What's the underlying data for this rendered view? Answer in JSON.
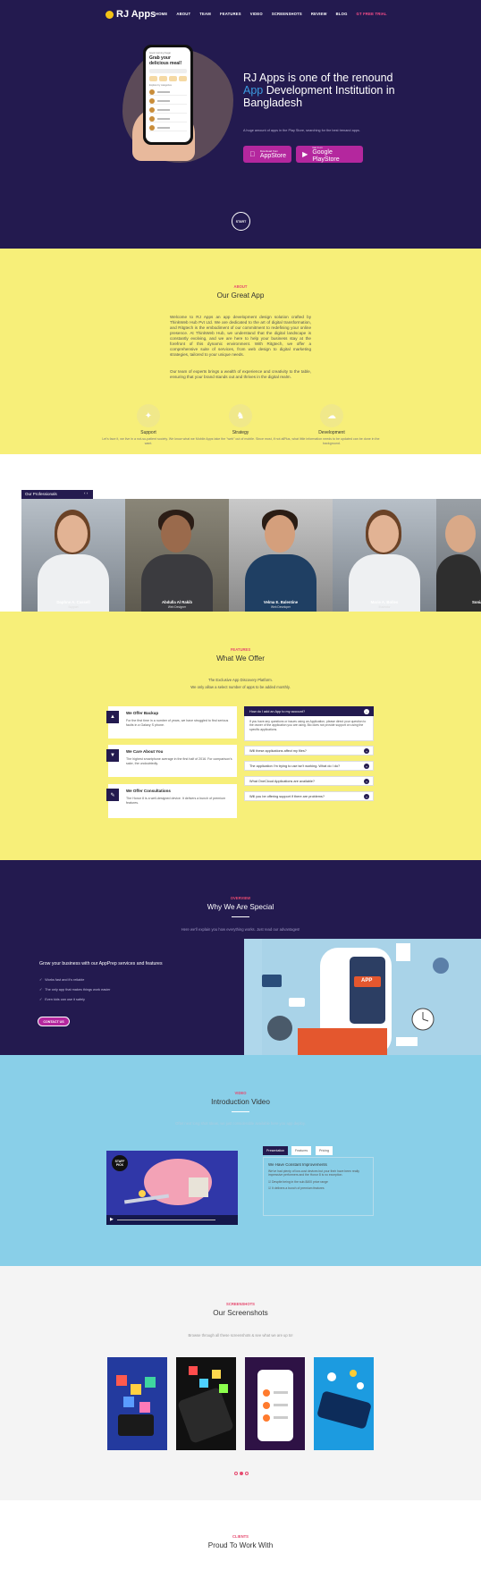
{
  "nav": {
    "logo": "RJ Apps",
    "links": [
      "HOME",
      "ABOUT",
      "TEAM",
      "FEATURES",
      "VIDEO",
      "SCREENSHOTS",
      "REVIEW",
      "BLOG",
      "GT FREE TRIAL"
    ]
  },
  "hero": {
    "phone": {
      "subtitle": "Good morning Sugar",
      "title": "Grab your delicious meal!",
      "list_title": "Explore by categories"
    },
    "title_before": "RJ Apps is one of the renound ",
    "title_accent": "App",
    "title_after": " Development Institution in Bangladesh",
    "subtitle": "A huge amount of apps in the Play Store, searching for the best trenand apps.",
    "appstore": {
      "small": "Download from",
      "big": "AppStore"
    },
    "playstore": {
      "small": "Get it on",
      "big": "Google PlayStore"
    },
    "start": "START"
  },
  "about": {
    "kicker": "ABOUT",
    "title": "Our Great App",
    "para1": "Welcome to RJ Apps an app development design solution crafted by ThinkWeb Hub Pvt Ltd. We are dedicated to the art of digital transformation, and Ritgtech is the embodiment of our commitment to redefining your online presence. At ThinkWeb Hub, we understand that the digital landscape is constantly evolving, and we are here to help your business stay at the forefront of this dynamic environment. With Ritgtech, we offer a comprehensive suite of services, from web design to digital marketing strategies, tailored to your unique needs.",
    "para2": "Our team of experts brings a wealth of experience and creativity to the table, ensuring that your brand stands out and thrives in the digital realm.",
    "features": [
      {
        "title": "Support",
        "desc": "Let's face it, we live in a not-so-patient society. We know what we want.",
        "icon": "support-icon",
        "glyph": "✦"
      },
      {
        "title": "Strategy",
        "desc": "Mobile Apps take the \"web\" out of mobile. Since most, if not all.",
        "icon": "strategy-icon",
        "glyph": "♞"
      },
      {
        "title": "Development",
        "desc": "Plus, what little information needs to be updated can be done in the background.",
        "icon": "development-icon",
        "glyph": "☁"
      }
    ]
  },
  "team": {
    "label": "Our Professionals",
    "arrows": "‹ ›",
    "members": [
      {
        "name": "Daphne A. Cassell",
        "role": "Support"
      },
      {
        "name": "Abdulla Al Rakib",
        "role": "Web Designer"
      },
      {
        "name": "Velma E. Balentine",
        "role": "Web Developer"
      },
      {
        "name": "Marie A. Bolles",
        "role": "Illustrator"
      },
      {
        "name": "Sonia",
        "role": ""
      }
    ]
  },
  "features": {
    "kicker": "FEATURES",
    "title": "What We Offer",
    "sub1": "The Exclusive App Discovery Platform.",
    "sub2": "We only allow a select number of apps to be added monthly.",
    "cards": [
      {
        "title": "We Offer Backup",
        "desc": "For the first time in a number of years, we have struggled to find serious faults in a Galaxy S phone.",
        "icon": "backup-icon",
        "glyph": "▲"
      },
      {
        "title": "We Care About You",
        "desc": "The highest smartphone average in the first half of 2016. For comparison's sake, the undoubtedly.",
        "icon": "care-icon",
        "glyph": "▼"
      },
      {
        "title": "We Offer Consultations",
        "desc": "The Honor 8 is a well-designed device. It delivers a bunch of premium features.",
        "icon": "consultation-icon",
        "glyph": "✎"
      }
    ],
    "faqs": [
      {
        "q": "How do I add an App to my account?",
        "open": true,
        "a": "If you have any questions or issues using an Application, please direct your question to the owner of the application you are using. Bio does not provide support on using the specific applications."
      },
      {
        "q": "Will these applications affect my files?"
      },
      {
        "q": "The application I'm trying to use isn't working. What do I do?"
      },
      {
        "q": "What OneCloud Applications are available?"
      },
      {
        "q": "Will you be offering support if there are problems?"
      }
    ]
  },
  "special": {
    "kicker": "OVERVIEW",
    "title": "Why We Are Special",
    "sub": "Here we'll explain you how everything works. Just read our advantages!",
    "heading": "Grow your business with our AppPrep services and features",
    "items": [
      "Works fast and it's reliable",
      "The only app that makes things work easier",
      "Even kids can use it safely"
    ],
    "button": "CONTACT US",
    "illustration_text": "APP"
  },
  "video": {
    "kicker": "VIDEO",
    "title": "Introduction Video",
    "sub": "Oftet next long shot Ideas, we just considerable available here you app deploy.",
    "badge": "STAFF PICK",
    "tabs": [
      "Presentation",
      "Features",
      "Pricing"
    ],
    "panel_title": "We Have Constant Improvements",
    "panel_text": "We've had plenty of low-cost devices but your their have been really impressive performers and the Honor 8 is no exception.",
    "panel_items": [
      "Despite being in the sub-$400 price range",
      "It delivers a bunch of premium features"
    ]
  },
  "screenshots": {
    "kicker": "SCREENSHOTS",
    "title": "Our Screenshots",
    "sub": "Browse through all these screenshots & see what we are up to!"
  },
  "clients": {
    "kicker": "CLIENTS",
    "title": "Proud To Work With"
  },
  "colors": {
    "navy": "#231a4f",
    "yellow": "#f7ef79",
    "pink": "#e64a6f",
    "magenta": "#b4279e",
    "sky": "#89cfe8"
  }
}
